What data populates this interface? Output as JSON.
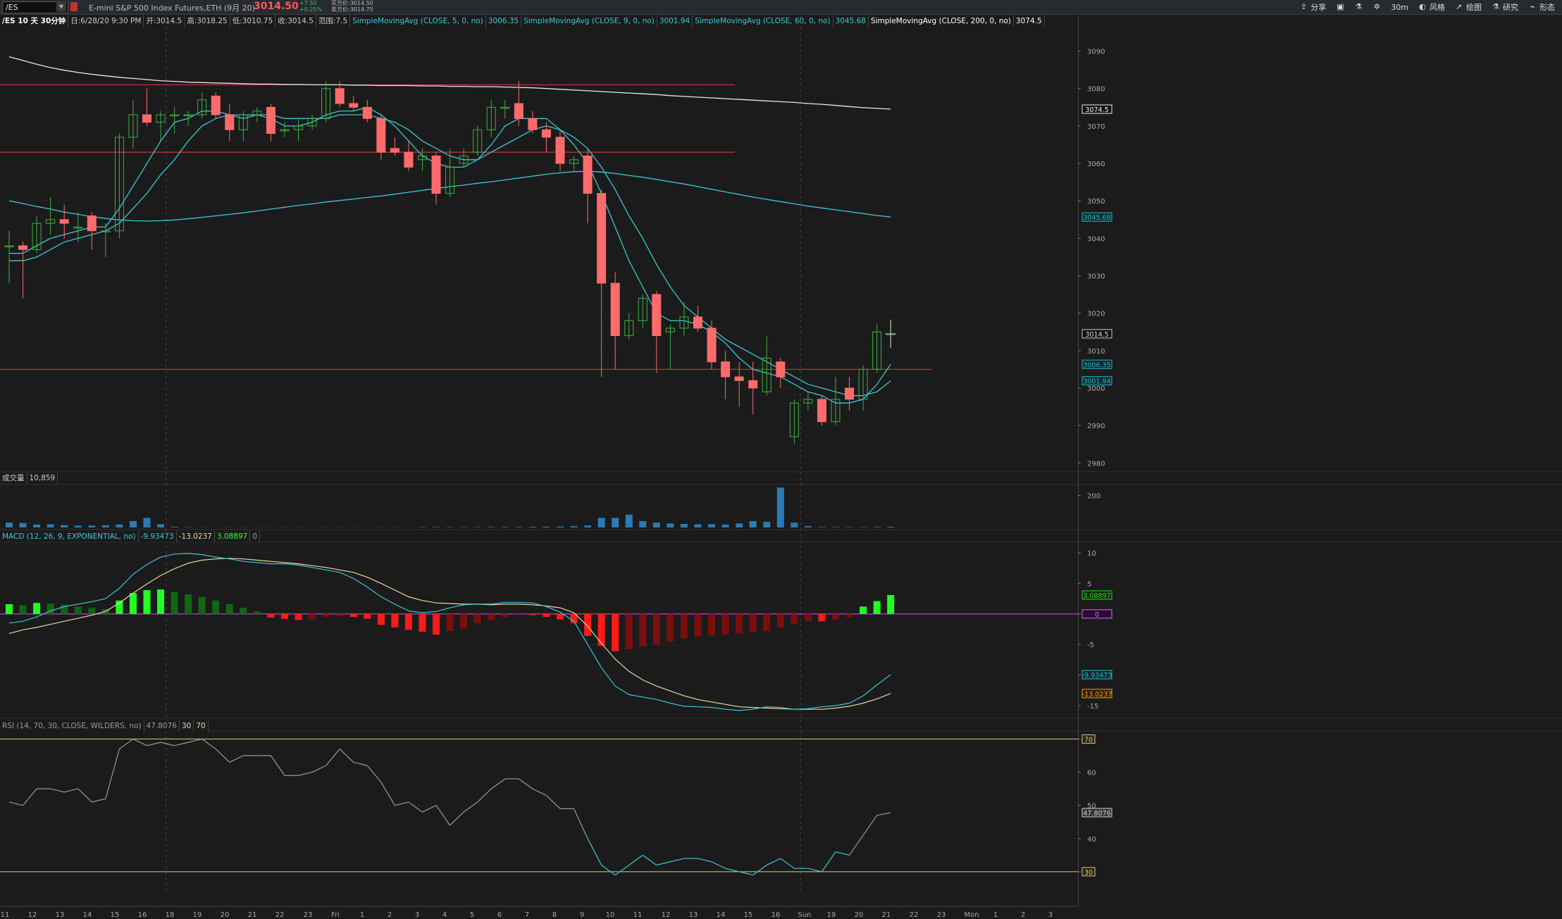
{
  "toolbar": {
    "symbol": "/ES",
    "description": "E-mini S&P 500 Index Futures,ETH (9月 20)",
    "last_price": "3014.50",
    "change": "+7.50",
    "change_pct": "+0.25%",
    "bid": "买方价:3014.50",
    "ask": "卖方价:3014.75",
    "share_label": "分享",
    "timeframe_label": "30m",
    "style_label": "风格",
    "draw_label": "绘图",
    "research_label": "研究",
    "patterns_label": "形态"
  },
  "info": {
    "chart_title": "/ES 10 天 30分钟",
    "date": "日:6/28/20 9:30 PM",
    "open": "开:3014.5",
    "high": "高:3018.25",
    "low": "低:3010.75",
    "close": "收:3014.5",
    "range": "范围:7.5",
    "sma5_label": "SimpleMovingAvg (CLOSE, 5, 0, no)",
    "sma5_value": "3006.35",
    "sma9_label": "SimpleMovingAvg (CLOSE, 9, 0, no)",
    "sma9_value": "3001.94",
    "sma60_label": "SimpleMovingAvg (CLOSE, 60, 0, no)",
    "sma60_value": "3045.68",
    "sma200_label": "SimpleMovingAvg (CLOSE, 200, 0, no)",
    "sma200_value": "3074.5"
  },
  "volume_pane": {
    "label": "成交量",
    "value": "10,859"
  },
  "macd_pane": {
    "label": "MACD (12, 26, 9, EXPONENTIAL, no)",
    "value": "-9.93473",
    "avg": "-13.0237",
    "diff": "3.08897",
    "zero": "0"
  },
  "rsi_pane": {
    "label": "RSI (14, 70, 30, CLOSE, WILDERS, no)",
    "value": "47.8076",
    "os": "30",
    "ob": "70"
  },
  "colors": {
    "up": "#3cb043",
    "down": "#ff6b6b",
    "sma5": "#3cc7d6",
    "sma9": "#3cc7d6",
    "sma60": "#3cc7d6",
    "sma200": "#e8e8e8",
    "macd": "#3cc7d6",
    "avg": "#e8d8a0",
    "volume": "#2a7bb5",
    "rsi": "#9a9a9a"
  },
  "chart_data": {
    "type": "line",
    "title": "/ES 10 天 30分钟",
    "price_axis": {
      "ticks": [
        2980,
        2990,
        3000,
        3010,
        3020,
        3030,
        3040,
        3050,
        3060,
        3070,
        3080,
        3090
      ],
      "range": [
        2978,
        3095
      ]
    },
    "price_flags": [
      {
        "value": 3074.5,
        "text": "3074.5",
        "kind": "sma200"
      },
      {
        "value": 3045.68,
        "text": "3045.68",
        "kind": "sma60"
      },
      {
        "value": 3014.5,
        "text": "3014.5",
        "kind": "last"
      },
      {
        "value": 3006.35,
        "text": "3006.35",
        "kind": "sma5"
      },
      {
        "value": 3001.94,
        "text": "3001.94",
        "kind": "sma9"
      }
    ],
    "x_ticks": [
      "11",
      "12",
      "13",
      "14",
      "15",
      "16",
      "18",
      "19",
      "20",
      "21",
      "22",
      "23",
      "Fri",
      "1",
      "2",
      "3",
      "4",
      "5",
      "6",
      "7",
      "8",
      "9",
      "10",
      "11",
      "12",
      "13",
      "14",
      "15",
      "16",
      "Sun",
      "19",
      "20",
      "21",
      "22",
      "23",
      "Mon",
      "1",
      "2",
      "3"
    ],
    "horizontal_lines": [
      3081,
      3063,
      3005
    ],
    "candles": [
      {
        "o": 3038,
        "h": 3042,
        "l": 3028,
        "c": 3038
      },
      {
        "o": 3038,
        "h": 3039,
        "l": 3024,
        "c": 3037
      },
      {
        "o": 3037,
        "h": 3046,
        "l": 3036,
        "c": 3044
      },
      {
        "o": 3044,
        "h": 3051,
        "l": 3041,
        "c": 3045
      },
      {
        "o": 3045,
        "h": 3049,
        "l": 3040,
        "c": 3044
      },
      {
        "o": 3043,
        "h": 3047,
        "l": 3039,
        "c": 3043
      },
      {
        "o": 3046,
        "h": 3047,
        "l": 3037,
        "c": 3042
      },
      {
        "o": 3042,
        "h": 3044,
        "l": 3035,
        "c": 3042
      },
      {
        "o": 3042,
        "h": 3068,
        "l": 3040,
        "c": 3067
      },
      {
        "o": 3067,
        "h": 3077,
        "l": 3064,
        "c": 3073
      },
      {
        "o": 3073,
        "h": 3080,
        "l": 3070,
        "c": 3071
      },
      {
        "o": 3071,
        "h": 3074,
        "l": 3066,
        "c": 3073
      },
      {
        "o": 3073,
        "h": 3075,
        "l": 3068,
        "c": 3073
      },
      {
        "o": 3073,
        "h": 3074,
        "l": 3070,
        "c": 3073
      },
      {
        "o": 3073,
        "h": 3079,
        "l": 3072,
        "c": 3077
      },
      {
        "o": 3078,
        "h": 3079,
        "l": 3072,
        "c": 3073
      },
      {
        "o": 3073,
        "h": 3076,
        "l": 3066,
        "c": 3069
      },
      {
        "o": 3069,
        "h": 3074,
        "l": 3066,
        "c": 3073
      },
      {
        "o": 3073,
        "h": 3075,
        "l": 3071,
        "c": 3074
      },
      {
        "o": 3075,
        "h": 3076,
        "l": 3066,
        "c": 3068
      },
      {
        "o": 3069,
        "h": 3071,
        "l": 3067,
        "c": 3069
      },
      {
        "o": 3069,
        "h": 3072,
        "l": 3066,
        "c": 3070
      },
      {
        "o": 3070,
        "h": 3073,
        "l": 3069,
        "c": 3072
      },
      {
        "o": 3072,
        "h": 3082,
        "l": 3071,
        "c": 3080
      },
      {
        "o": 3080,
        "h": 3082,
        "l": 3075,
        "c": 3076
      },
      {
        "o": 3076,
        "h": 3078,
        "l": 3074,
        "c": 3075
      },
      {
        "o": 3075,
        "h": 3077,
        "l": 3071,
        "c": 3072
      },
      {
        "o": 3072,
        "h": 3073,
        "l": 3061,
        "c": 3063
      },
      {
        "o": 3064,
        "h": 3067,
        "l": 3062,
        "c": 3063
      },
      {
        "o": 3063,
        "h": 3066,
        "l": 3058,
        "c": 3059
      },
      {
        "o": 3061,
        "h": 3064,
        "l": 3058,
        "c": 3062
      },
      {
        "o": 3062,
        "h": 3063,
        "l": 3049,
        "c": 3052
      },
      {
        "o": 3052,
        "h": 3064,
        "l": 3051,
        "c": 3059
      },
      {
        "o": 3060,
        "h": 3064,
        "l": 3059,
        "c": 3062
      },
      {
        "o": 3063,
        "h": 3070,
        "l": 3062,
        "c": 3069
      },
      {
        "o": 3069,
        "h": 3077,
        "l": 3067,
        "c": 3075
      },
      {
        "o": 3075,
        "h": 3077,
        "l": 3072,
        "c": 3075
      },
      {
        "o": 3076,
        "h": 3082,
        "l": 3070,
        "c": 3072
      },
      {
        "o": 3072,
        "h": 3074,
        "l": 3068,
        "c": 3069
      },
      {
        "o": 3069,
        "h": 3071,
        "l": 3063,
        "c": 3067
      },
      {
        "o": 3067,
        "h": 3069,
        "l": 3058,
        "c": 3060
      },
      {
        "o": 3060,
        "h": 3062,
        "l": 3058,
        "c": 3061
      },
      {
        "o": 3062,
        "h": 3064,
        "l": 3044,
        "c": 3052
      },
      {
        "o": 3052,
        "h": 3053,
        "l": 3003,
        "c": 3028
      },
      {
        "o": 3028,
        "h": 3031,
        "l": 3005,
        "c": 3014
      },
      {
        "o": 3014,
        "h": 3020,
        "l": 3013,
        "c": 3018
      },
      {
        "o": 3018,
        "h": 3025,
        "l": 3016,
        "c": 3024
      },
      {
        "o": 3025,
        "h": 3026,
        "l": 3004,
        "c": 3014
      },
      {
        "o": 3015,
        "h": 3017,
        "l": 3005,
        "c": 3016
      },
      {
        "o": 3016,
        "h": 3023,
        "l": 3014,
        "c": 3019
      },
      {
        "o": 3019,
        "h": 3022,
        "l": 3015,
        "c": 3016
      },
      {
        "o": 3016,
        "h": 3018,
        "l": 3005,
        "c": 3007
      },
      {
        "o": 3007,
        "h": 3010,
        "l": 2997,
        "c": 3003
      },
      {
        "o": 3003,
        "h": 3007,
        "l": 2995,
        "c": 3002
      },
      {
        "o": 3002,
        "h": 3007,
        "l": 2993,
        "c": 3000
      },
      {
        "o": 2999,
        "h": 3014,
        "l": 2998,
        "c": 3008
      },
      {
        "o": 3007,
        "h": 3008,
        "l": 3000,
        "c": 3003
      },
      {
        "o": 2987,
        "h": 2997,
        "l": 2985,
        "c": 2996
      },
      {
        "o": 2996,
        "h": 2999,
        "l": 2994,
        "c": 2997
      },
      {
        "o": 2997,
        "h": 2998,
        "l": 2990,
        "c": 2991
      },
      {
        "o": 2991,
        "h": 3003,
        "l": 2990,
        "c": 2997
      },
      {
        "o": 3000,
        "h": 3003,
        "l": 2994,
        "c": 2997
      },
      {
        "o": 2997,
        "h": 3006,
        "l": 2994,
        "c": 3005
      },
      {
        "o": 3005,
        "h": 3017,
        "l": 3004,
        "c": 3015
      },
      {
        "o": 3014.5,
        "h": 3018.25,
        "l": 3010.75,
        "c": 3014.5
      }
    ],
    "sma200": [
      3088.5,
      3087.5,
      3086.5,
      3085.6,
      3084.9,
      3084.3,
      3083.8,
      3083.4,
      3083.0,
      3082.7,
      3082.4,
      3082.1,
      3081.9,
      3081.7,
      3081.6,
      3081.5,
      3081.4,
      3081.3,
      3081.2,
      3081.2,
      3081.1,
      3081.1,
      3081.0,
      3081.0,
      3081.0,
      3080.9,
      3080.9,
      3080.8,
      3080.8,
      3080.8,
      3080.7,
      3080.7,
      3080.6,
      3080.6,
      3080.5,
      3080.5,
      3080.4,
      3080.3,
      3080.2,
      3080.0,
      3079.8,
      3079.6,
      3079.4,
      3079.2,
      3079.0,
      3078.8,
      3078.6,
      3078.4,
      3078.1,
      3077.9,
      3077.7,
      3077.5,
      3077.3,
      3077.1,
      3076.9,
      3076.7,
      3076.5,
      3076.3,
      3076.0,
      3075.8,
      3075.5,
      3075.2,
      3074.9,
      3074.7,
      3074.5
    ],
    "sma60": [
      3050,
      3049.3,
      3048.5,
      3047.8,
      3047.0,
      3046.4,
      3045.8,
      3045.3,
      3044.9,
      3044.7,
      3044.6,
      3044.7,
      3044.9,
      3045.2,
      3045.6,
      3046.0,
      3046.4,
      3046.8,
      3047.3,
      3047.8,
      3048.3,
      3048.8,
      3049.2,
      3049.7,
      3050.1,
      3050.5,
      3050.9,
      3051.3,
      3051.8,
      3052.3,
      3052.8,
      3053.3,
      3053.8,
      3054.2,
      3054.7,
      3055.1,
      3055.6,
      3056.1,
      3056.6,
      3057.1,
      3057.5,
      3057.8,
      3057.9,
      3057.7,
      3057.3,
      3056.8,
      3056.3,
      3055.7,
      3055.1,
      3054.5,
      3053.8,
      3053.1,
      3052.4,
      3051.7,
      3051.0,
      3050.4,
      3049.8,
      3049.2,
      3048.6,
      3048.1,
      3047.6,
      3047.1,
      3046.6,
      3046.1,
      3045.68
    ],
    "sma5": [
      3036,
      3036,
      3038,
      3040,
      3041,
      3042,
      3043,
      3043,
      3048,
      3054,
      3060,
      3066,
      3071,
      3072,
      3074,
      3074,
      3073,
      3072,
      3073,
      3072,
      3070,
      3070,
      3071,
      3073,
      3074,
      3074,
      3075,
      3073,
      3070,
      3066,
      3062,
      3060,
      3059,
      3059,
      3061,
      3065,
      3070,
      3072,
      3072,
      3072,
      3069,
      3065,
      3060,
      3052,
      3043,
      3034,
      3027,
      3020,
      3018,
      3018,
      3017,
      3015,
      3012,
      3008,
      3005,
      3004,
      3003,
      3001,
      2999,
      2998,
      2996,
      2996,
      2997,
      3001,
      3006.35
    ],
    "sma9": [
      3034,
      3034,
      3035,
      3037,
      3039,
      3040,
      3041,
      3042,
      3044,
      3048,
      3052,
      3057,
      3061,
      3066,
      3070,
      3072,
      3073,
      3073,
      3073,
      3073,
      3072,
      3072,
      3072,
      3072,
      3073,
      3073,
      3073,
      3072,
      3071,
      3069,
      3066,
      3064,
      3062,
      3061,
      3061,
      3063,
      3065,
      3067,
      3069,
      3070,
      3069,
      3067,
      3064,
      3059,
      3053,
      3046,
      3040,
      3033,
      3027,
      3022,
      3019,
      3016,
      3013,
      3011,
      3009,
      3007,
      3005,
      3003,
      3001,
      3000,
      2999,
      2998,
      2998,
      2999,
      3001.94
    ],
    "volume": {
      "ticks": [
        200
      ],
      "max": 260,
      "values": [
        30,
        28,
        18,
        20,
        15,
        12,
        12,
        14,
        18,
        40,
        60,
        20,
        4,
        2,
        1,
        1,
        1,
        1,
        1,
        1,
        1,
        1,
        1,
        1,
        1,
        1,
        1,
        1,
        1,
        1,
        2,
        3,
        2,
        2,
        2,
        3,
        3,
        3,
        4,
        5,
        6,
        8,
        12,
        60,
        60,
        80,
        40,
        30,
        25,
        22,
        20,
        20,
        18,
        25,
        40,
        35,
        250,
        30,
        8,
        3,
        3,
        2,
        2,
        3,
        4
      ]
    },
    "macd": {
      "ticks": [
        10,
        5,
        0,
        -5,
        -10,
        -15
      ],
      "range": [
        -16.5,
        11.5
      ],
      "hist": [
        1.6,
        1.4,
        1.8,
        1.7,
        1.5,
        1.2,
        1.0,
        0.8,
        2.2,
        3.4,
        3.9,
        4.0,
        3.6,
        3.2,
        2.8,
        2.2,
        1.6,
        1.0,
        0.4,
        -0.6,
        -0.8,
        -1.0,
        -0.9,
        -0.5,
        -0.4,
        -0.5,
        -0.8,
        -1.8,
        -2.2,
        -2.6,
        -2.9,
        -3.4,
        -2.8,
        -2.4,
        -1.5,
        -1.0,
        -0.5,
        -0.2,
        -0.2,
        -0.5,
        -0.9,
        -1.5,
        -3.6,
        -5.2,
        -6.1,
        -5.8,
        -5.3,
        -5.0,
        -4.5,
        -4.0,
        -3.7,
        -3.5,
        -3.4,
        -3.2,
        -3.0,
        -2.8,
        -2.2,
        -1.6,
        -1.2,
        -1.2,
        -0.9,
        -0.5,
        1.2,
        2.1,
        3.08897
      ],
      "value": [
        -1.5,
        -1.2,
        -0.5,
        0.5,
        1.2,
        1.6,
        2.0,
        2.5,
        4.2,
        6.5,
        8.1,
        9.3,
        9.8,
        9.9,
        9.7,
        9.3,
        9.0,
        8.6,
        8.4,
        8.2,
        8.2,
        8.0,
        7.6,
        7.2,
        6.8,
        5.8,
        4.4,
        2.8,
        1.6,
        0.5,
        0.2,
        0.4,
        1.0,
        1.5,
        1.6,
        1.6,
        1.9,
        1.9,
        1.8,
        1.2,
        0.3,
        -1.2,
        -5.0,
        -8.8,
        -11.8,
        -13.2,
        -13.6,
        -14.0,
        -14.6,
        -15.1,
        -15.2,
        -15.3,
        -15.6,
        -15.8,
        -15.6,
        -15.2,
        -15.3,
        -15.6,
        -15.5,
        -15.2,
        -15.0,
        -14.6,
        -13.4,
        -11.6,
        -9.93473
      ],
      "avg": [
        -3.2,
        -2.6,
        -2.2,
        -1.7,
        -1.2,
        -0.7,
        -0.2,
        0.4,
        1.8,
        3.4,
        4.9,
        6.3,
        7.4,
        8.3,
        8.8,
        9.0,
        9.1,
        9.0,
        8.8,
        8.6,
        8.4,
        8.2,
        7.9,
        7.6,
        7.2,
        6.8,
        6.0,
        5.0,
        3.9,
        2.8,
        2.2,
        1.8,
        1.7,
        1.6,
        1.6,
        1.5,
        1.6,
        1.6,
        1.5,
        1.3,
        1.0,
        0.2,
        -2.0,
        -4.8,
        -7.4,
        -9.4,
        -10.8,
        -11.8,
        -12.6,
        -13.4,
        -14.0,
        -14.4,
        -14.8,
        -15.2,
        -15.3,
        -15.4,
        -15.5,
        -15.6,
        -15.6,
        -15.6,
        -15.4,
        -15.1,
        -14.6,
        -13.9,
        -13.0237
      ]
    },
    "rsi": {
      "ticks": [
        70,
        60,
        50,
        40,
        30
      ],
      "range": [
        20,
        72
      ],
      "values": [
        51,
        50,
        55,
        55,
        54,
        55,
        51,
        52,
        67,
        70,
        68,
        69,
        68,
        69,
        70,
        67,
        63,
        65,
        65,
        65,
        59,
        59,
        60,
        62,
        67,
        63,
        62,
        57,
        50,
        51,
        48,
        50,
        44,
        48,
        51,
        55,
        58,
        58,
        55,
        53,
        49,
        49,
        40,
        32,
        29,
        32,
        35,
        32,
        33,
        34,
        34,
        33,
        31,
        30,
        29,
        32,
        34,
        31,
        31,
        30,
        36,
        35,
        41,
        47,
        47.8076
      ]
    }
  }
}
